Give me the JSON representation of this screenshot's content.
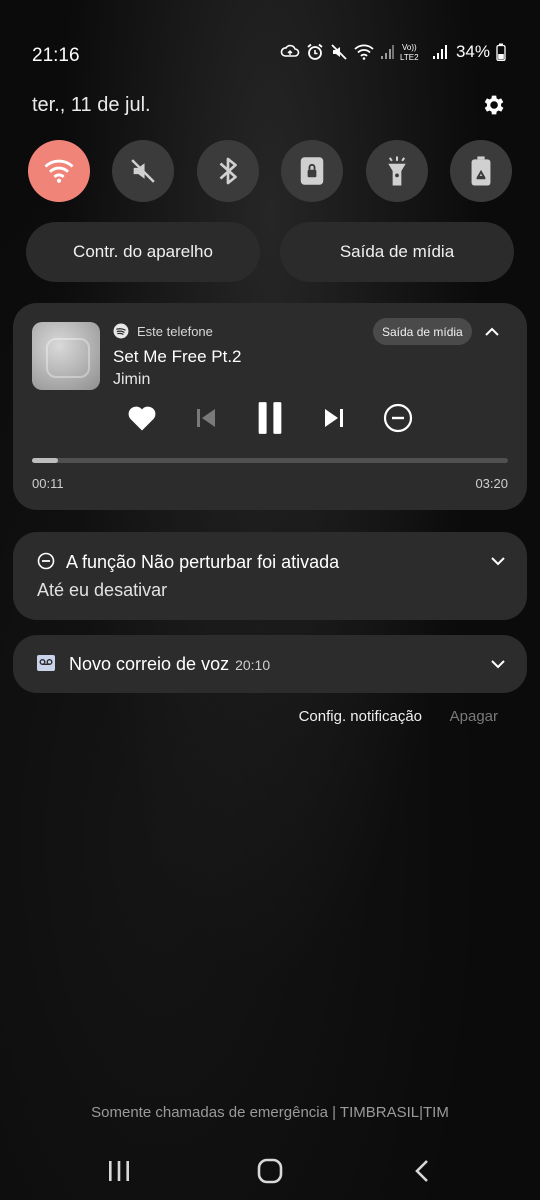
{
  "status_bar": {
    "time": "21:16",
    "network_label": "Vo)) LTE2",
    "battery": "34%",
    "icons": [
      "cloud-sync-icon",
      "alarm-icon",
      "mute-icon",
      "wifi-icon",
      "signal-icon",
      "volte-icon",
      "signal-icon",
      "battery-icon"
    ]
  },
  "header": {
    "date": "ter., 11 de jul.",
    "settings_icon": "gear-icon"
  },
  "quick_settings": [
    {
      "name": "wifi",
      "icon": "wifi-icon",
      "active": true
    },
    {
      "name": "sound",
      "icon": "mute-icon",
      "active": false
    },
    {
      "name": "bluetooth",
      "icon": "bluetooth-icon",
      "active": false
    },
    {
      "name": "rotation-lock",
      "icon": "lock-icon",
      "active": false
    },
    {
      "name": "flashlight",
      "icon": "flashlight-icon",
      "active": false
    },
    {
      "name": "power-saving",
      "icon": "battery-recycle-icon",
      "active": false
    }
  ],
  "pills": {
    "device_control": "Contr. do aparelho",
    "media_output": "Saída de mídia"
  },
  "media": {
    "source": "Este telefone",
    "output_chip": "Saída de mídia",
    "title": "Set Me Free Pt.2",
    "artist": "Jimin",
    "elapsed": "00:11",
    "total": "03:20",
    "progress": 0.055
  },
  "notifications": {
    "dnd": {
      "title": "A função Não perturbar foi ativada",
      "subtitle": "Até eu desativar"
    },
    "voicemail": {
      "title": "Novo correio de voz",
      "time": "20:10"
    }
  },
  "actions": {
    "settings": "Config. notificação",
    "clear": "Apagar"
  },
  "carrier_text": "Somente chamadas de emergência | TIMBRASIL|TIM",
  "colors": {
    "accent": "#f18479",
    "tile": "#3b3b3c",
    "card": "#2c2c2d"
  }
}
